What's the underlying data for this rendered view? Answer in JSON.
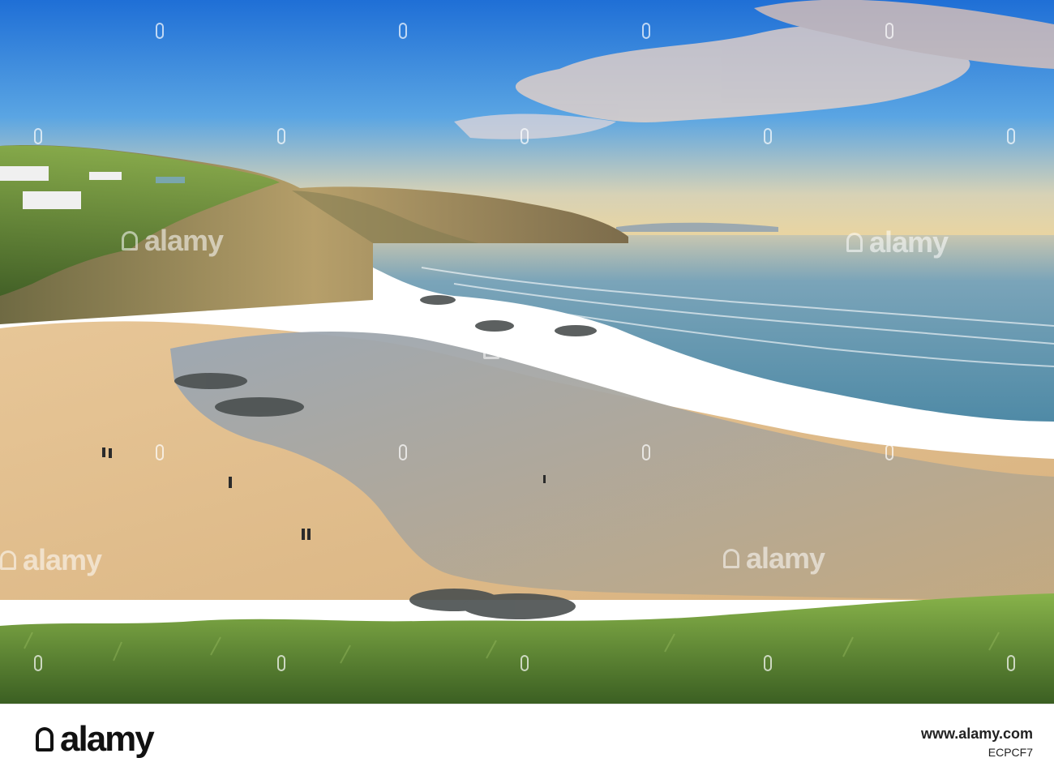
{
  "photo": {
    "alt": "Coastal bay at sunset with sandy beach, cliffs, and sea"
  },
  "watermark": {
    "text": "alamy"
  },
  "footer": {
    "logo_text": "alamy",
    "site": "www.alamy.com",
    "image_id": "ECPCF7"
  },
  "colors": {
    "sky_top": "#1f6fd6",
    "sky_bottom": "#f5d89a",
    "sea": "#5a8fb1",
    "sand": "#e6c79a",
    "grass": "#5f8d34",
    "cliff": "#8a7a55"
  }
}
